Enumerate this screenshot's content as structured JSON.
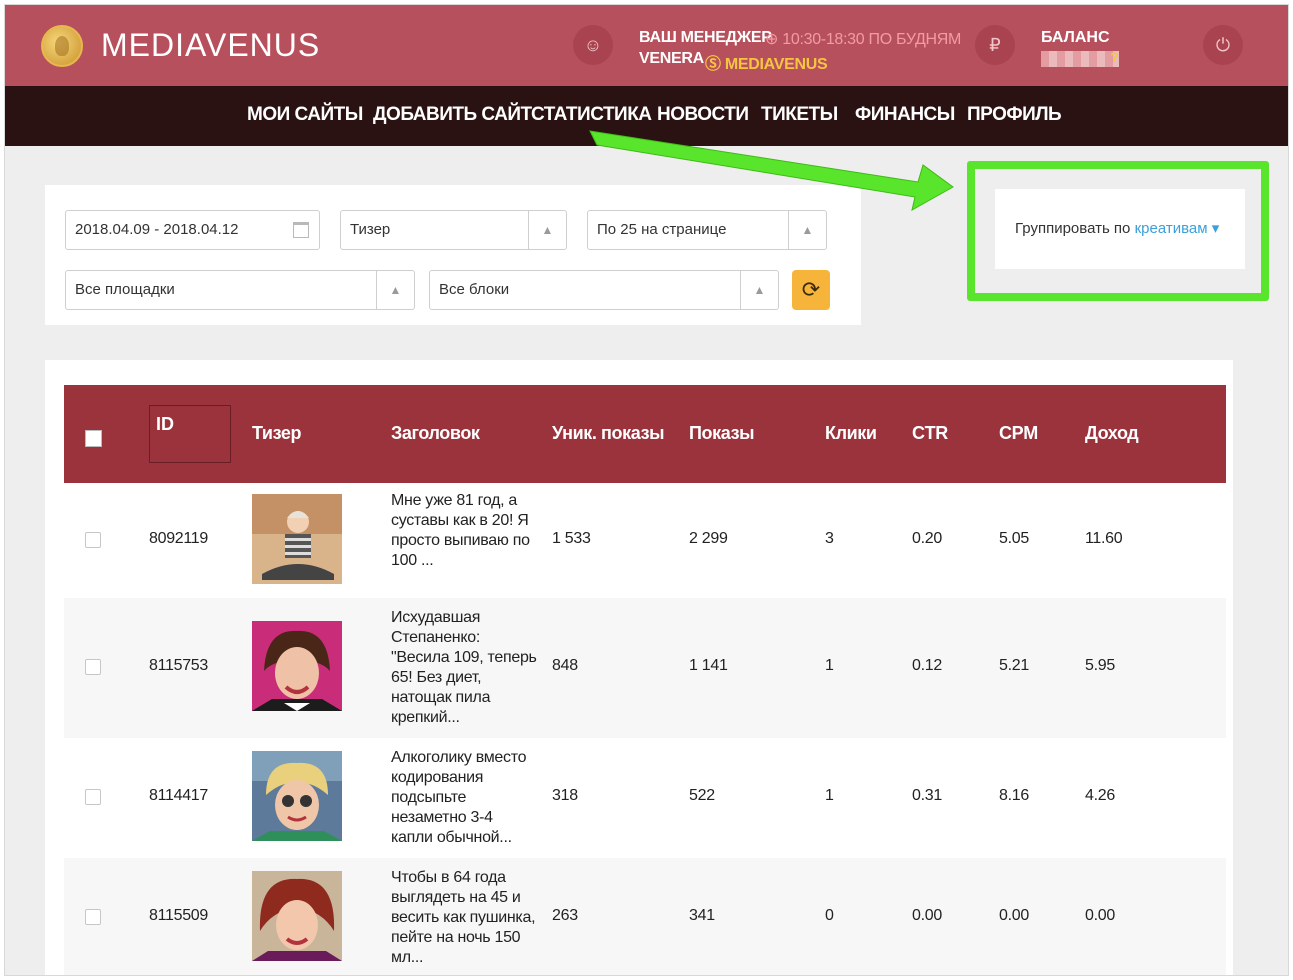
{
  "header": {
    "brand": "MEDIAVENUS",
    "manager_label": "ВАШ МЕНЕДЖЕР",
    "manager_hours": "⊕ 10:30-18:30 ПО БУДНЯМ",
    "manager_name": "VENERA",
    "manager_skype": "Ⓢ MEDIAVENUS",
    "balance_label": "БАЛАНС",
    "balance_suffix": "?"
  },
  "nav": {
    "items": [
      "МОИ САЙТЫ",
      "ДОБАВИТЬ САЙТ",
      "СТАТИСТИКА",
      "НОВОСТИ",
      "ТИКЕТЫ",
      "ФИНАНСЫ",
      "ПРОФИЛЬ"
    ]
  },
  "filters": {
    "date_range": "2018.04.09 - 2018.04.12",
    "type": "Тизер",
    "per_page": "По 25 на странице",
    "sites": "Все площадки",
    "blocks": "Все блоки"
  },
  "grouping": {
    "label": "Группировать по",
    "value": "креативам"
  },
  "table": {
    "headers": [
      "ID",
      "Тизер",
      "Заголовок",
      "Уник. показы",
      "Показы",
      "Клики",
      "CTR",
      "CPM",
      "Доход"
    ],
    "rows": [
      {
        "id": "8092119",
        "title": "Мне уже 81 год, а суставы как в 20! Я просто выпиваю по 100 ...",
        "unique": "1 533",
        "views": "2 299",
        "clicks": "3",
        "ctr": "0.20",
        "cpm": "5.05",
        "income": "11.60"
      },
      {
        "id": "8115753",
        "title": "Исхудавшая Степаненко: \"Весила 109, теперь 65! Без диет, натощак пила крепкий...",
        "unique": "848",
        "views": "1 141",
        "clicks": "1",
        "ctr": "0.12",
        "cpm": "5.21",
        "income": "5.95"
      },
      {
        "id": "8114417",
        "title": "Алкоголику вместо кодирования подсыпьте незаметно 3-4 капли обычной...",
        "unique": "318",
        "views": "522",
        "clicks": "1",
        "ctr": "0.31",
        "cpm": "8.16",
        "income": "4.26"
      },
      {
        "id": "8115509",
        "title": "Чтобы в 64 года выглядеть на 45 и весить как пушинка, пейте на ночь 150 мл...",
        "unique": "263",
        "views": "341",
        "clicks": "0",
        "ctr": "0.00",
        "cpm": "0.00",
        "income": "0.00"
      }
    ]
  },
  "colors": {
    "topbar": "#b7505d",
    "nav": "#2a1212",
    "table_header": "#9b333d",
    "accent_link": "#3ba0d9",
    "highlight_green": "#59e52c",
    "refresh_button": "#f6b53a"
  }
}
